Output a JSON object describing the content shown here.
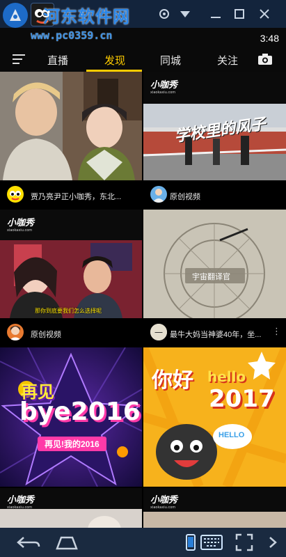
{
  "window": {
    "watermark_title": "河东软件网",
    "watermark_url": "www.pc0359.cn"
  },
  "status": {
    "time": "3:48"
  },
  "tabs": [
    "直播",
    "发现",
    "同城",
    "关注"
  ],
  "active_tab": "发现",
  "feed": [
    {
      "caption": "贾乃亮尹正小咖秀，东北..."
    },
    {
      "caption": "原创视频",
      "overlay_text": "学校里的风子",
      "brand": "小咖秀"
    },
    {
      "caption": "原创视频",
      "brand": "小咖秀",
      "subtitle": "那你到底要我们怎么选择呢"
    },
    {
      "caption": "最牛大妈当神婆40年，坐...",
      "overlay_text": "宇宙翻译官"
    },
    {
      "poster_line1": "再见",
      "poster_line2": "bye2016",
      "poster_line3": "再见!我的2016"
    },
    {
      "poster_line1": "你好",
      "poster_line2": "hello",
      "poster_line3": "2017",
      "bubble": "HELLO"
    },
    {
      "brand": "小咖秀"
    },
    {
      "brand": "小咖秀"
    }
  ],
  "brand_sub": "xiaokaxiu.com",
  "colors": {
    "accent": "#ffcc00",
    "titlebar": "#13243c",
    "background": "#000000"
  }
}
